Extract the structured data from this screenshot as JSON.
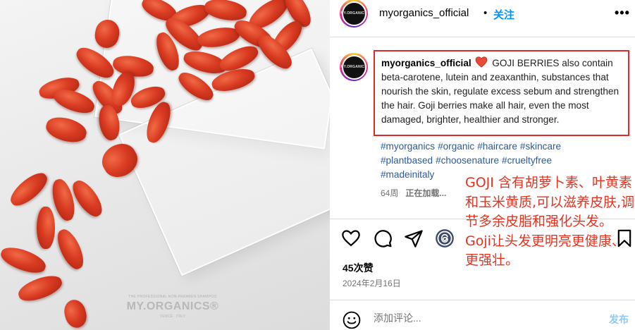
{
  "header": {
    "username": "myorganics_official",
    "dot": "•",
    "follow_label": "关注",
    "avatar_text": "MY.ORGANICS"
  },
  "caption": {
    "username": "myorganics_official",
    "text": " GOJI BERRIES also contain beta-carotene, lutein and zeaxanthin, substances that nourish the skin, regulate excess sebum and strengthen the hair. Goji berries make all hair, even the most damaged, brighter, healthier and stronger."
  },
  "hashtags": [
    "#myorganics",
    "#organic",
    "#haircare",
    "#skincare",
    "#plantbased",
    "#choosenature",
    "#crueltyfree",
    "#madeinitaly"
  ],
  "meta": {
    "age": "64周",
    "loading": "正在加载..."
  },
  "note": "GOJI 含有胡萝卜素、叶黄素和玉米黄质,可以滋养皮肤,调节多余皮脂和强化头发。 Goji让头发更明亮更健康、更强壮。",
  "likes": "45次赞",
  "date": "2024年2月16日",
  "comment": {
    "placeholder": "添加评论...",
    "post_label": "发布"
  },
  "photo": {
    "logo_small": "THE PROFESSIONAL NON-PARABEN SHAMPOO",
    "logo": "MY.ORGANICS®",
    "logo_sub": "VENICE · ITALY"
  },
  "colors": {
    "highlight_border": "#e02a2a",
    "note_text": "#e53320",
    "follow": "#0095f6",
    "hashtag": "#2b5b9c"
  }
}
